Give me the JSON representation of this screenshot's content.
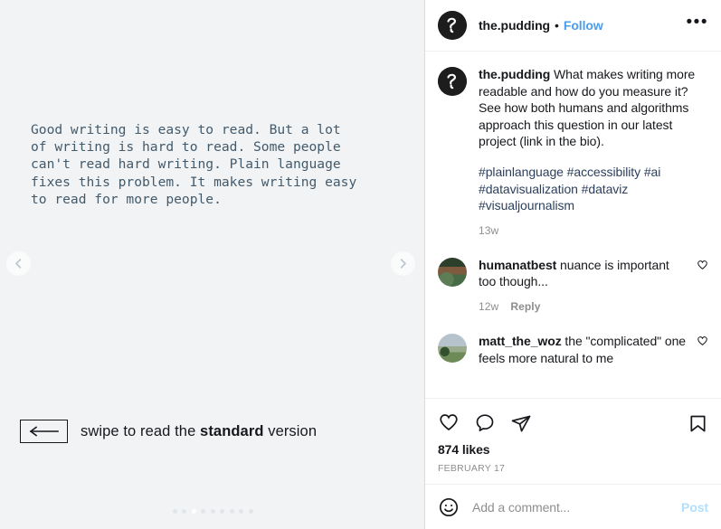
{
  "media": {
    "slide_text": "Good writing is easy to read. But a lot\nof writing is hard to read. Some people\ncan't read hard writing. Plain language\nfixes this problem. It makes writing easy\nto read for more people.",
    "swipe_prefix": "swipe to read the ",
    "swipe_bold": "standard",
    "swipe_suffix": " version",
    "prev_icon": "chevron-left-icon",
    "next_icon": "chevron-right-icon",
    "arrow_icon": "long-arrow-left-icon",
    "dot_count": 9,
    "active_dot_index": 2,
    "text_color": "#435a6b",
    "background": "#f1f3f5"
  },
  "header": {
    "username": "the.pudding",
    "separator": "•",
    "follow_label": "Follow",
    "more_label": "•••",
    "follow_color": "#4a9cec"
  },
  "caption": {
    "username": "the.pudding",
    "text": " What makes writing more readable and how do you measure it? See how both humans and algorithms approach this question in our latest project (link in the bio).",
    "hashtags": "#plainlanguage #accessibility #ai #datavisualization #dataviz #visualjournalism",
    "timestamp": "13w",
    "hashtag_color": "#2c3f5c"
  },
  "comments": [
    {
      "username": "humanatbest",
      "text": " nuance is important too though...",
      "timestamp": "12w",
      "reply_label": "Reply",
      "like_icon": "heart-outline-icon",
      "avatar": "nature"
    },
    {
      "username": "matt_the_woz",
      "text": " the \"complicated\" one feels more natural to me",
      "timestamp": "",
      "reply_label": "",
      "like_icon": "heart-outline-icon",
      "avatar": "landscape"
    }
  ],
  "actions": {
    "like_icon": "heart-outline-icon",
    "comment_icon": "comment-bubble-icon",
    "share_icon": "paper-plane-icon",
    "save_icon": "bookmark-outline-icon",
    "likes": "874 likes",
    "date": "FEBRUARY 17"
  },
  "add_comment": {
    "emoji_icon": "smiley-face-icon",
    "placeholder": "Add a comment...",
    "value": "",
    "post_label": "Post",
    "post_color": "#b2dffc"
  }
}
